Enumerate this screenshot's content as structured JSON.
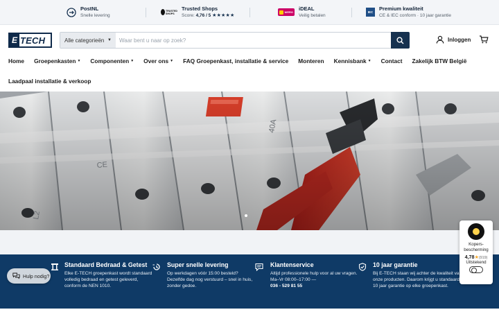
{
  "usp_bar": [
    {
      "title": "PostNL",
      "subtitle": "Snelle levering",
      "icon": "postnl-icon"
    },
    {
      "title": "Trusted Shops",
      "score_label": "Score:",
      "score": "4,76 / 5",
      "stars": "★★★★★",
      "icon": "trusted-shops-logo"
    },
    {
      "title": "iDEAL",
      "subtitle": "Veilig betalen",
      "icon": "ideal-logo",
      "logo_text": "WERO"
    },
    {
      "title": "Premium kwaliteit",
      "subtitle": "CE & IEC conform · 10 jaar garantie",
      "icon": "iec-logo",
      "logo_text": "IEC"
    }
  ],
  "header": {
    "logo_mark": "E",
    "logo_word": "TECH",
    "category_select": "Alle categorieën",
    "search_placeholder": "Waar bent u naar op zoek?",
    "login_label": "Inloggen"
  },
  "nav": [
    {
      "label": "Home",
      "has_dropdown": false
    },
    {
      "label": "Groepenkasten",
      "has_dropdown": true
    },
    {
      "label": "Componenten",
      "has_dropdown": true
    },
    {
      "label": "Over ons",
      "has_dropdown": true
    },
    {
      "label": "FAQ Groepenkast, installatie & service",
      "has_dropdown": false
    },
    {
      "label": "Monteren",
      "has_dropdown": false
    },
    {
      "label": "Kennisbank",
      "has_dropdown": true
    },
    {
      "label": "Contact",
      "has_dropdown": false
    },
    {
      "label": "Zakelijk BTW België",
      "has_dropdown": false
    }
  ],
  "nav_row2": {
    "label": "Laadpaal installatie & verkoop"
  },
  "features": [
    {
      "title": "Standaard Bedraad & Getest",
      "text": "Elke E-TECH groepenkast wordt standaard volledig bedraad en getest geleverd, conform de NEN 1010.",
      "icon": "fuse-box-icon"
    },
    {
      "title": "Super snelle levering",
      "text": "Op werkdagen vóór 15:00 besteld? Dezelfde dag nog verstuurd – snel in huis, zonder gedoe.",
      "icon": "fast-clock-icon"
    },
    {
      "title": "Klantenservice",
      "text": "Altijd professionele hulp voor al uw vragen. Ma–Vr 08:00–17:00 —",
      "phone": "036 - 529 81 55",
      "icon": "chat-icon"
    },
    {
      "title": "10 jaar garantie",
      "text": "Bij E-TECH staan wij achter de kwaliteit van onze producten. Daarom krijgt u standaard 10 jaar garantie op elke groepenkast.",
      "icon": "shield-check-icon"
    }
  ],
  "help_button": {
    "label": "Hulp nodig?"
  },
  "trust_badge": {
    "label": "Kopers-bescherming",
    "score": "4,78",
    "count": "(919)",
    "verdict": "Uitstekend"
  },
  "hero_slider": {
    "current": 1
  }
}
